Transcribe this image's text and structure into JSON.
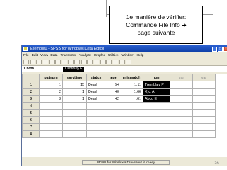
{
  "callout": {
    "line1": "1e manière de vérifier:",
    "line2": "Commande File Info",
    "line3": "page suivante"
  },
  "window": {
    "title": "Exemple1 - SPSS for Windows Data Editor",
    "menus": [
      "File",
      "Edit",
      "View",
      "Data",
      "Transform",
      "Analyze",
      "Graphs",
      "Utilities",
      "Window",
      "Help"
    ],
    "cell_ref": "1:nom",
    "cell_value": "Tremblay P",
    "columns": [
      "patnum",
      "survtime",
      "status",
      "age",
      "mismatch",
      "nom",
      "var",
      "var"
    ],
    "rows": [
      {
        "n": "1",
        "patnum": "1",
        "survtime": "15",
        "status": "Dead",
        "age": "54",
        "mismatch": "1.11",
        "nom": "Tremblay P"
      },
      {
        "n": "2",
        "patnum": "2",
        "survtime": "1",
        "status": "Dead",
        "age": "40",
        "mismatch": "1.66",
        "nom": "Xyz A"
      },
      {
        "n": "3",
        "patnum": "3",
        "survtime": "1",
        "status": "Dead",
        "age": "42",
        "mismatch": ".61",
        "nom": "Abcd E"
      }
    ],
    "empty_rows": [
      "4",
      "5",
      "6",
      "7",
      "8"
    ],
    "status": "SPSS for Windows Processor is ready"
  },
  "page_number": "26",
  "colors": {
    "title_bar": "#0b3da5",
    "selection": "#000000",
    "chrome": "#ece9d8"
  }
}
